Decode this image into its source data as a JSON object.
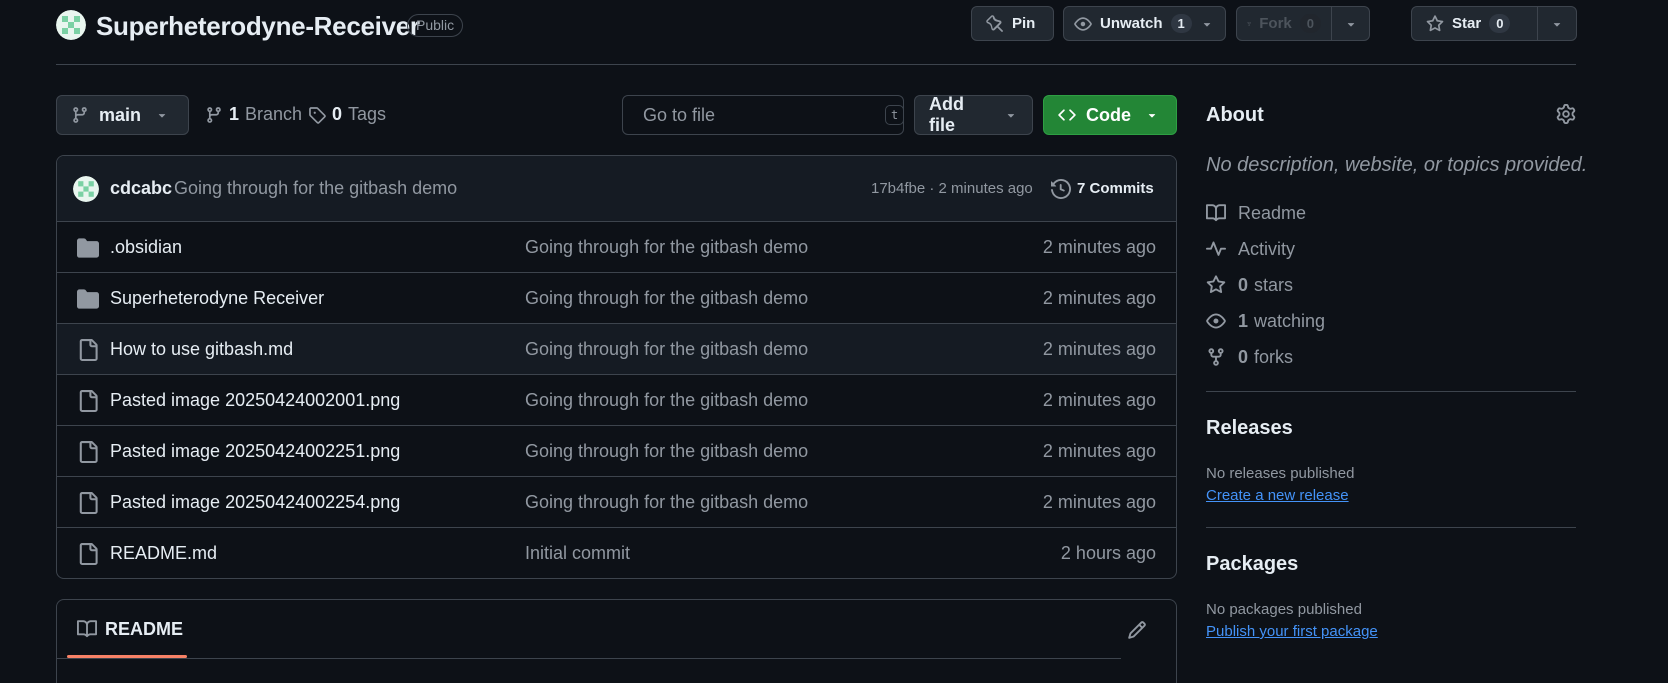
{
  "repo": {
    "name": "Superheterodyne-Receiver",
    "visibility": "Public"
  },
  "actions": {
    "pin_label": "Pin",
    "unwatch_label": "Unwatch",
    "unwatch_count": "1",
    "fork_label": "Fork",
    "fork_count": "0",
    "star_label": "Star",
    "star_count": "0"
  },
  "toolbar": {
    "branch_name": "main",
    "branches_count": "1",
    "branches_label": "Branch",
    "tags_count": "0",
    "tags_label": "Tags",
    "goto_placeholder": "Go to file",
    "goto_shortcut": "t",
    "add_file_label": "Add file",
    "code_label": "Code"
  },
  "latest_commit": {
    "author": "cdcabc",
    "message": "Going through for the gitbash demo",
    "meta": "17b4fbe · 2 minutes ago",
    "commits_label": "7 Commits"
  },
  "files": [
    {
      "type": "folder",
      "name": ".obsidian",
      "message": "Going through for the gitbash demo",
      "time": "2 minutes ago"
    },
    {
      "type": "folder",
      "name": "Superheterodyne Receiver",
      "message": "Going through for the gitbash demo",
      "time": "2 minutes ago"
    },
    {
      "type": "file",
      "name": "How to use gitbash.md",
      "message": "Going through for the gitbash demo",
      "time": "2 minutes ago"
    },
    {
      "type": "file",
      "name": "Pasted image 20250424002001.png",
      "message": "Going through for the gitbash demo",
      "time": "2 minutes ago"
    },
    {
      "type": "file",
      "name": "Pasted image 20250424002251.png",
      "message": "Going through for the gitbash demo",
      "time": "2 minutes ago"
    },
    {
      "type": "file",
      "name": "Pasted image 20250424002254.png",
      "message": "Going through for the gitbash demo",
      "time": "2 minutes ago"
    },
    {
      "type": "file",
      "name": "README.md",
      "message": "Initial commit",
      "time": "2 hours ago"
    }
  ],
  "readme": {
    "tab_label": "README"
  },
  "about": {
    "title": "About",
    "description": "No description, website, or topics provided.",
    "readme_label": "Readme",
    "activity_label": "Activity",
    "stars_count": "0",
    "stars_label": "stars",
    "watching_count": "1",
    "watching_label": "watching",
    "forks_count": "0",
    "forks_label": "forks"
  },
  "releases": {
    "title": "Releases",
    "empty_text": "No releases published",
    "create_link": "Create a new release"
  },
  "packages": {
    "title": "Packages",
    "empty_text": "No packages published",
    "publish_link": "Publish your first package"
  },
  "colors": {
    "background": "#0d1117",
    "border": "#3d444d",
    "text": "#e6edf3",
    "muted": "#9198a1",
    "accent_green": "#238636",
    "link": "#4493f8",
    "tab_underline": "#f78166"
  },
  "icons": [
    "repo-avatar",
    "pin-icon",
    "eye-icon",
    "fork-icon",
    "star-icon",
    "caret-down-icon",
    "branch-icon",
    "tag-icon",
    "search-icon",
    "code-icon",
    "history-icon",
    "folder-icon",
    "file-icon",
    "book-icon",
    "pulse-icon",
    "gear-icon",
    "pencil-icon"
  ]
}
